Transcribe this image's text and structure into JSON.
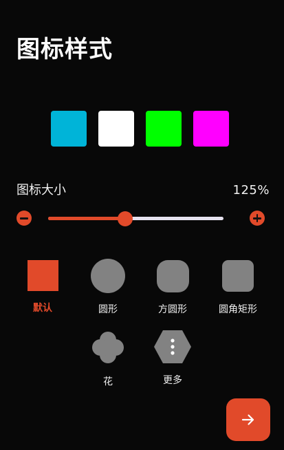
{
  "title": "图标样式",
  "colors": {
    "accent": "#e14a2a",
    "shape_fill": "#828282",
    "background": "#080808"
  },
  "swatches": [
    {
      "name": "cyan",
      "color": "#00b4d8"
    },
    {
      "name": "white",
      "color": "#ffffff"
    },
    {
      "name": "green",
      "color": "#00ff00"
    },
    {
      "name": "magenta",
      "color": "#ff00ff"
    }
  ],
  "icon_size": {
    "label": "图标大小",
    "value_text": "125%",
    "slider_fraction": 0.44
  },
  "shapes": [
    {
      "label": "默认",
      "kind": "default",
      "selected": true
    },
    {
      "label": "圆形",
      "kind": "circle",
      "selected": false
    },
    {
      "label": "方圆形",
      "kind": "squircle",
      "selected": false
    },
    {
      "label": "圆角矩形",
      "kind": "rounded",
      "selected": false
    },
    {
      "label": "花",
      "kind": "flower",
      "selected": false
    },
    {
      "label": "更多",
      "kind": "hex-more",
      "selected": false
    }
  ],
  "next_button": {
    "icon": "arrow-right-icon"
  }
}
